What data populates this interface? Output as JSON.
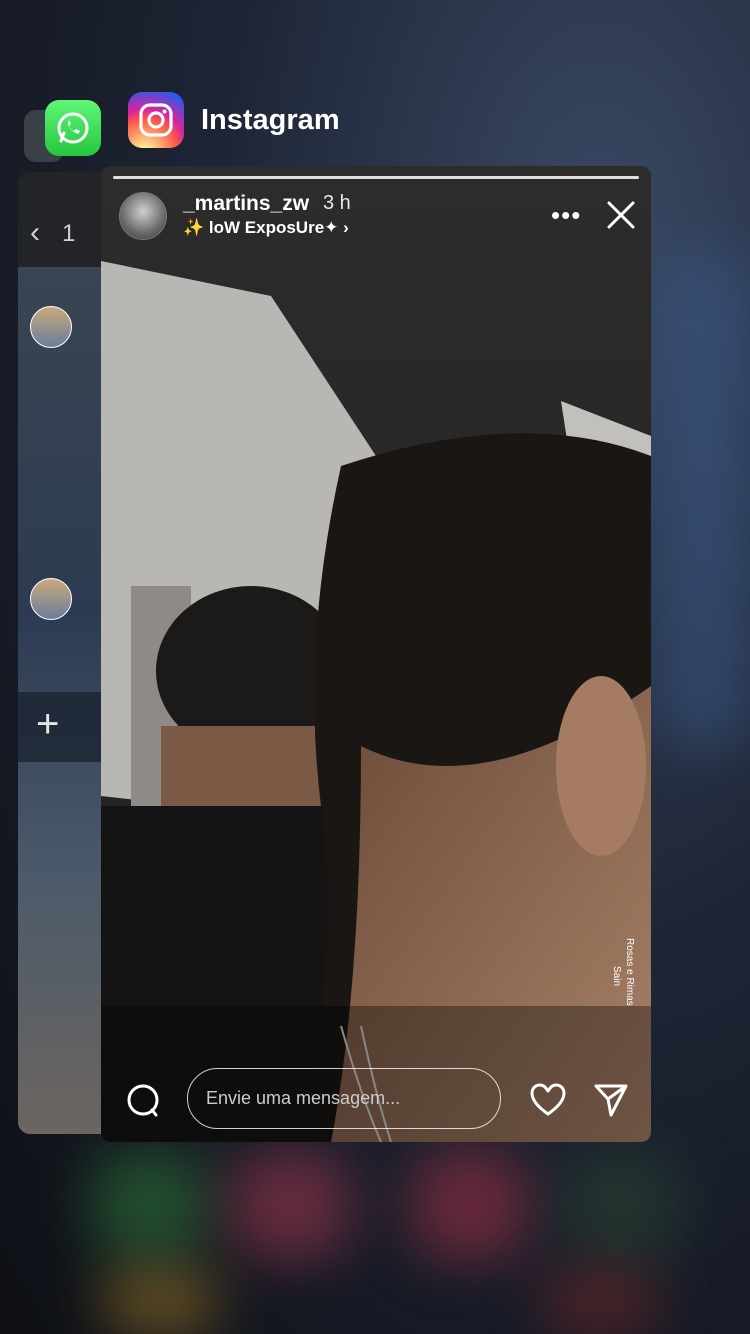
{
  "app_switcher": {
    "current_app_name": "Instagram"
  },
  "whatsapp_card": {
    "back_count": "1"
  },
  "story": {
    "username": "_martins_zw",
    "posted_ago": "3 h",
    "audio_label": "loW ExposUre✦",
    "music_sticker_line1": "Rosas e Rimas",
    "music_sticker_line2": "Sain",
    "reply_placeholder": "Envie uma mensagem..."
  },
  "icons": [
    "whatsapp-icon",
    "instagram-icon",
    "more-icon",
    "close-icon",
    "camera-icon",
    "heart-icon",
    "send-icon",
    "sparkle-icon",
    "chevron-right-icon",
    "back-icon",
    "plus-icon"
  ],
  "colors": {
    "instagram_brand_gradient": [
      "#fdf497",
      "#fd5949",
      "#d6249f",
      "#285AEB"
    ],
    "whatsapp_green": "#27c63f"
  }
}
